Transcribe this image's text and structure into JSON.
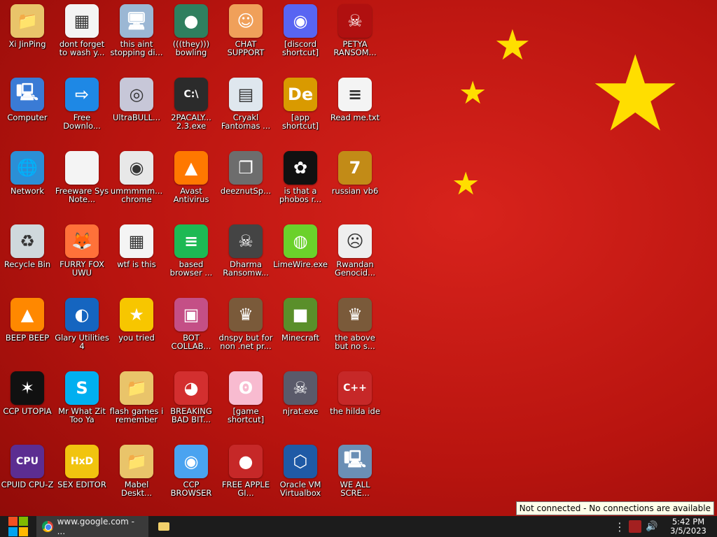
{
  "desktop": {
    "icons": [
      {
        "label": "Xi JinPing",
        "icon": "folder-user-icon",
        "glyph": "📁",
        "bg": "#e9c46a"
      },
      {
        "label": "dont forget to wash y...",
        "icon": "document-icon",
        "glyph": "▦",
        "bg": "#f4f4f4"
      },
      {
        "label": "this aint stopping di...",
        "icon": "computer-scan-icon",
        "glyph": "🖥",
        "bg": "#9bb7d4"
      },
      {
        "label": "(((they))) bowling",
        "icon": "game-icon",
        "glyph": "●",
        "bg": "#2f7f5f"
      },
      {
        "label": "CHAT SUPPORT",
        "icon": "person-icon",
        "glyph": "☺",
        "bg": "#f0a05a"
      },
      {
        "label": "[discord shortcut]",
        "icon": "discord-icon",
        "glyph": "◉",
        "bg": "#5865f2"
      },
      {
        "label": "PETYA RANSOM...",
        "icon": "skull-icon",
        "glyph": "☠",
        "bg": "#b01010"
      },
      {
        "label": "Computer",
        "icon": "computer-icon",
        "glyph": "🖳",
        "bg": "#3a7bd5"
      },
      {
        "label": "Free Downlo...",
        "icon": "download-icon",
        "glyph": "⇨",
        "bg": "#1e88e5"
      },
      {
        "label": "UltraBULL...",
        "icon": "disc-icon",
        "glyph": "◎",
        "bg": "#c7c7d8"
      },
      {
        "label": "2PACALY... 2.3.exe",
        "icon": "terminal-icon",
        "glyph": "C:\\",
        "bg": "#2b2b2b"
      },
      {
        "label": "Cryakl Fantomas ...",
        "icon": "window-icon",
        "glyph": "▤",
        "bg": "#dfe7ee"
      },
      {
        "label": "[app shortcut]",
        "icon": "de-app-icon",
        "glyph": "De",
        "bg": "#d99a00"
      },
      {
        "label": "Read me.txt",
        "icon": "text-file-icon",
        "glyph": "≡",
        "bg": "#f4f4f4"
      },
      {
        "label": "Network",
        "icon": "network-icon",
        "glyph": "🌐",
        "bg": "#2b8fd6"
      },
      {
        "label": "Freeware Sys Note...",
        "icon": "blank-file-icon",
        "glyph": "",
        "bg": "#f4f4f4"
      },
      {
        "label": "ummmmm... chrome",
        "icon": "chrome-icon",
        "glyph": "◉",
        "bg": "#e8e8e8"
      },
      {
        "label": "Avast Antivirus",
        "icon": "avast-icon",
        "glyph": "▲",
        "bg": "#ff7800"
      },
      {
        "label": "deeznutSp...",
        "icon": "stack-icon",
        "glyph": "❐",
        "bg": "#6d6d6d"
      },
      {
        "label": "is that a phobos r...",
        "icon": "icq-flower-icon",
        "glyph": "✿",
        "bg": "#111"
      },
      {
        "label": "russian vb6",
        "icon": "vb6-icon",
        "glyph": "7",
        "bg": "#c28b17"
      },
      {
        "label": "Recycle Bin",
        "icon": "recycle-bin-icon",
        "glyph": "♻",
        "bg": "#cfd8dc"
      },
      {
        "label": "FURRY FOX UWU",
        "icon": "firefox-icon",
        "glyph": "🦊",
        "bg": "#ff7139"
      },
      {
        "label": "wtf is this",
        "icon": "document-icon",
        "glyph": "▦",
        "bg": "#f4f4f4"
      },
      {
        "label": "based browser ...",
        "icon": "doc-green-icon",
        "glyph": "≡",
        "bg": "#1db954"
      },
      {
        "label": "Dharma Ransomw...",
        "icon": "skull-icon",
        "glyph": "☠",
        "bg": "#444"
      },
      {
        "label": "LimeWire.exe",
        "icon": "limewire-icon",
        "glyph": "◍",
        "bg": "#6bd12b"
      },
      {
        "label": "Rwandan Genocid...",
        "icon": "face-icon",
        "glyph": "☹",
        "bg": "#eee"
      },
      {
        "label": "BEEP BEEP",
        "icon": "vlc-icon",
        "glyph": "▲",
        "bg": "#ff8800"
      },
      {
        "label": "Glary Utilities 4",
        "icon": "glary-icon",
        "glyph": "◐",
        "bg": "#1565c0"
      },
      {
        "label": "you tried",
        "icon": "star-icon",
        "glyph": "★",
        "bg": "#f7c600"
      },
      {
        "label": "BOT COLLAB...",
        "icon": "monitor-icon",
        "glyph": "▣",
        "bg": "#c44f86"
      },
      {
        "label": "dnspy but for non .net pr...",
        "icon": "portrait-icon",
        "glyph": "♛",
        "bg": "#7a5a3a"
      },
      {
        "label": "Minecraft",
        "icon": "minecraft-icon",
        "glyph": "■",
        "bg": "#5a8f2a"
      },
      {
        "label": "the above but no s...",
        "icon": "portrait-icon",
        "glyph": "♛",
        "bg": "#7a5a3a"
      },
      {
        "label": "CCP UTOPIA",
        "icon": "ccp-utopia-icon",
        "glyph": "✶",
        "bg": "#111"
      },
      {
        "label": "Mr What Zit Too Ya",
        "icon": "skype-icon",
        "glyph": "S",
        "bg": "#00aff0"
      },
      {
        "label": "flash games i remember",
        "icon": "folder-icon",
        "glyph": "📁",
        "bg": "#e9c46a"
      },
      {
        "label": "BREAKING BAD BIT...",
        "icon": "angry-bird-icon",
        "glyph": "◕",
        "bg": "#d32f2f"
      },
      {
        "label": "[game shortcut]",
        "icon": "pink-creature-icon",
        "glyph": "ʘ",
        "bg": "#f8bbd0"
      },
      {
        "label": "njrat.exe",
        "icon": "skull-icon",
        "glyph": "☠",
        "bg": "#5a5a6a"
      },
      {
        "label": "the hilda ide",
        "icon": "devcpp-icon",
        "glyph": "C++",
        "bg": "#c62828"
      },
      {
        "label": "CPUID CPU-Z",
        "icon": "cpuz-icon",
        "glyph": "CPU",
        "bg": "#5c2d91"
      },
      {
        "label": "SEX EDITOR",
        "icon": "hxd-icon",
        "glyph": "HxD",
        "bg": "#f1c40f"
      },
      {
        "label": "Mabel Deskt...",
        "icon": "folder-icon",
        "glyph": "📁",
        "bg": "#e9c46a"
      },
      {
        "label": "CCP BROWSER",
        "icon": "chromium-icon",
        "glyph": "◉",
        "bg": "#4aa3f0"
      },
      {
        "label": "FREE APPLE GI...",
        "icon": "apple-icon",
        "glyph": "●",
        "bg": "#c62828"
      },
      {
        "label": "Oracle VM Virtualbox",
        "icon": "virtualbox-icon",
        "glyph": "⬡",
        "bg": "#1f5aa6"
      },
      {
        "label": "WE ALL SCRE...",
        "icon": "computer-icon",
        "glyph": "🖳",
        "bg": "#6b8fb5"
      }
    ]
  },
  "taskbar": {
    "task_chrome_label": "www.google.com - ...",
    "tooltip": "Not connected - No connections are available",
    "time": "5:42 PM",
    "date": "3/5/2023"
  }
}
